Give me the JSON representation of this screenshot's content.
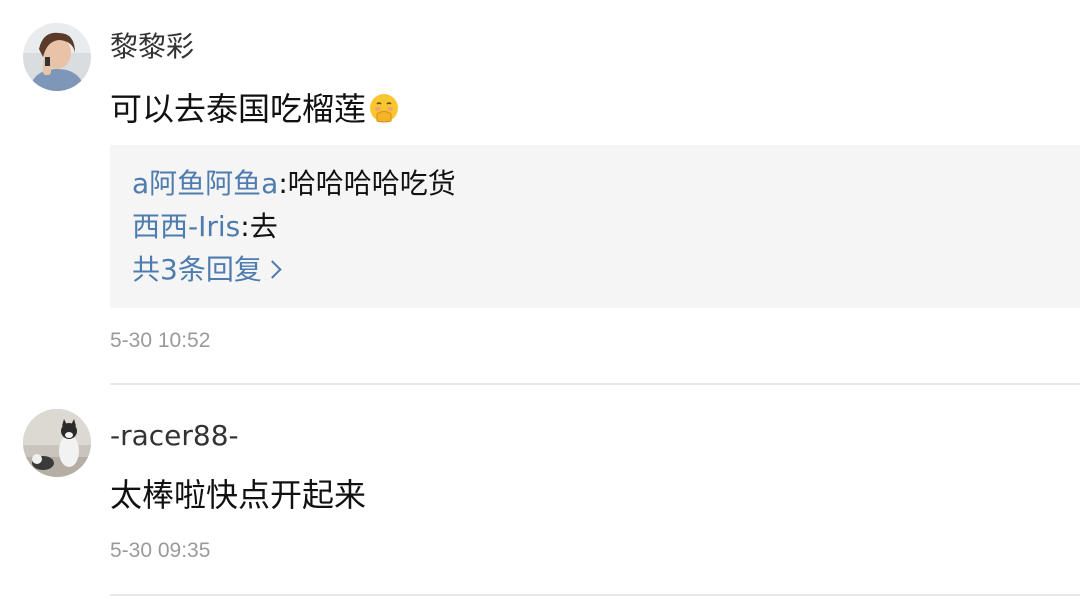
{
  "comments": [
    {
      "username": "黎黎彩",
      "text": "可以去泰国吃榴莲",
      "emoji": "face-with-hand-over-mouth-emoji",
      "replies": [
        {
          "user": "a阿鱼阿鱼a",
          "sep": ":",
          "text": "哈哈哈哈吃货"
        },
        {
          "user": "西西-Iris",
          "sep": ":",
          "text": "去"
        }
      ],
      "more_replies": "共3条回复",
      "time": "5-30 10:52"
    },
    {
      "username": "-racer88-",
      "text": "太棒啦快点开起来",
      "time": "5-30 09:35"
    }
  ],
  "colors": {
    "link": "#4f7cae",
    "reply_bg": "#f5f5f5",
    "time": "#9a9a9a",
    "divider": "#e8e8e8"
  }
}
